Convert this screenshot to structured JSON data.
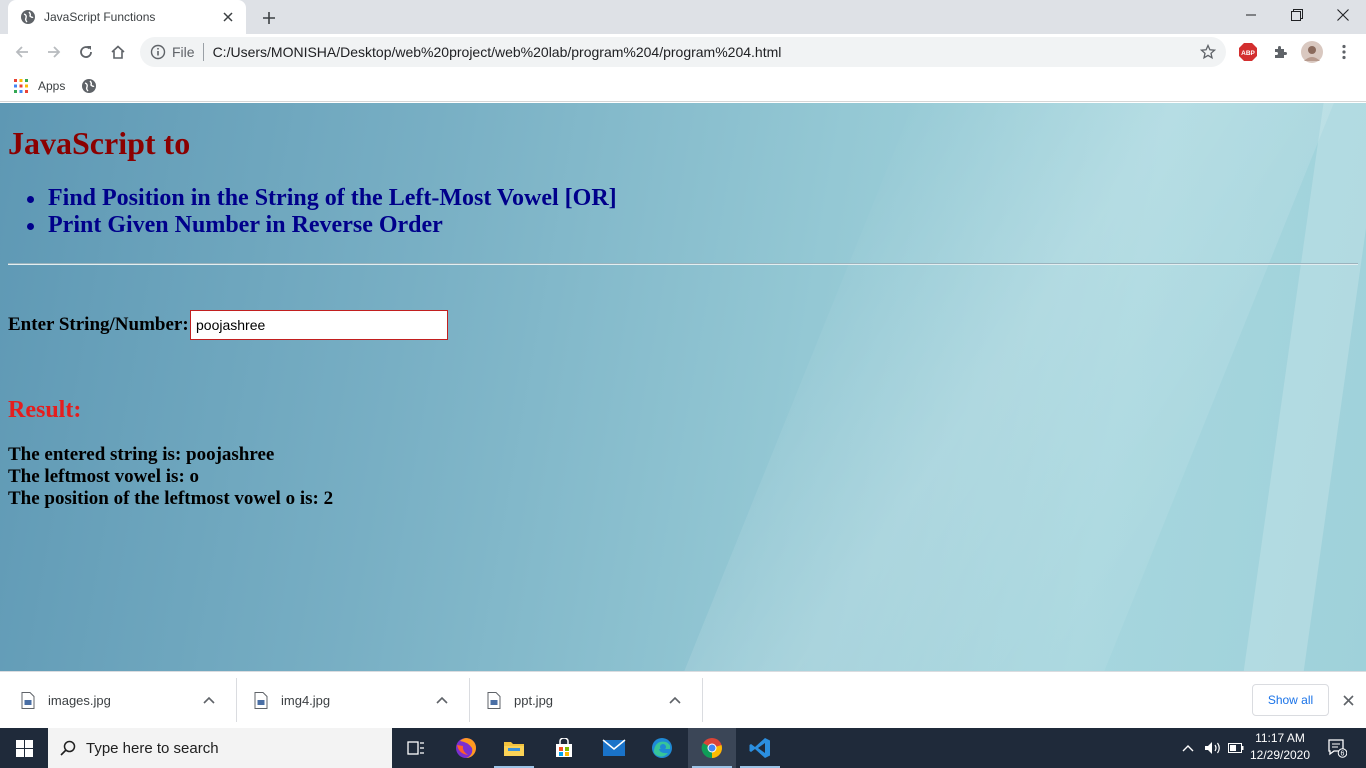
{
  "browser": {
    "tab": {
      "title": "JavaScript Functions"
    },
    "address": {
      "scheme_label": "File",
      "url": "C:/Users/MONISHA/Desktop/web%20project/web%20lab/program%204/program%204.html"
    },
    "extensions": {
      "abp_label": "ABP"
    },
    "bookmarks": {
      "apps_label": "Apps"
    }
  },
  "page": {
    "heading": "JavaScript to",
    "tasks": [
      "Find Position in the String of the Left-Most Vowel [OR]",
      "Print Given Number in Reverse Order"
    ],
    "form": {
      "label": "Enter String/Number:",
      "input_value": "poojashree"
    },
    "result": {
      "title": "Result:",
      "lines": [
        "The entered string is: poojashree",
        "The leftmost vowel is: o",
        "The position of the leftmost vowel o is: 2"
      ]
    }
  },
  "downloads": {
    "items": [
      {
        "name": "images.jpg"
      },
      {
        "name": "img4.jpg"
      },
      {
        "name": "ppt.jpg"
      }
    ],
    "show_all_label": "Show all"
  },
  "taskbar": {
    "search_placeholder": "Type here to search",
    "clock": {
      "time": "11:17 AM",
      "date": "12/29/2020"
    },
    "notification_count": "6"
  },
  "colors": {
    "heading": "#8b0000",
    "tasks": "#00008b",
    "result_title": "#e51e1e",
    "input_border": "#c21f1f"
  }
}
